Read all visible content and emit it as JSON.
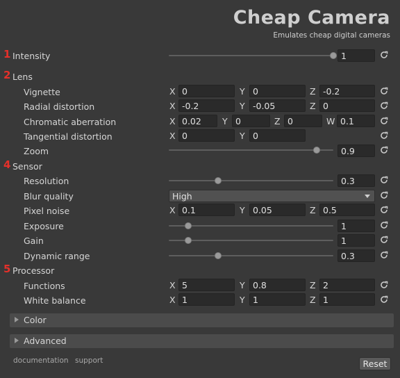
{
  "header": {
    "title": "Cheap Camera",
    "subtitle": "Emulates cheap digital cameras"
  },
  "sections": {
    "intensity": {
      "number": "1",
      "label": "Intensity",
      "value": "1",
      "level": 1.0
    },
    "lens": {
      "number": "2",
      "label": "Lens"
    },
    "sensor": {
      "number": "4",
      "label": "Sensor"
    },
    "processor": {
      "number": "5",
      "label": "Processor"
    }
  },
  "lens": {
    "vignette": {
      "label": "Vignette",
      "x": "0",
      "y": "0",
      "z": "-0.2"
    },
    "radial": {
      "label": "Radial distortion",
      "x": "-0.2",
      "y": "-0.05",
      "z": "0"
    },
    "chromatic": {
      "label": "Chromatic aberration",
      "x": "0.02",
      "y": "0",
      "z": "0",
      "w": "0.1"
    },
    "tangential": {
      "label": "Tangential distortion",
      "x": "0",
      "y": "0"
    },
    "zoom": {
      "label": "Zoom",
      "value": "0.9",
      "level": 0.9
    }
  },
  "sensor": {
    "resolution": {
      "label": "Resolution",
      "value": "0.3",
      "level": 0.3
    },
    "blur": {
      "label": "Blur quality",
      "selected": "High"
    },
    "noise": {
      "label": "Pixel noise",
      "x": "0.1",
      "y": "0.05",
      "z": "0.5"
    },
    "exposure": {
      "label": "Exposure",
      "value": "1",
      "level": 0.12
    },
    "gain": {
      "label": "Gain",
      "value": "1",
      "level": 0.12
    },
    "dynamic": {
      "label": "Dynamic range",
      "value": "0.3",
      "level": 0.3
    }
  },
  "processor": {
    "functions": {
      "label": "Functions",
      "x": "5",
      "y": "0.8",
      "z": "2"
    },
    "whitebalance": {
      "label": "White balance",
      "x": "1",
      "y": "1",
      "z": "1"
    }
  },
  "axes": {
    "x": "X",
    "y": "Y",
    "z": "Z",
    "w": "W"
  },
  "foldouts": {
    "color": "Color",
    "advanced": "Advanced"
  },
  "footer": {
    "documentation": "documentation",
    "support": "support",
    "reset": "Reset"
  },
  "colors": {
    "accent_red": "#e4302a",
    "background": "#393939",
    "field": "#2a2a2a"
  },
  "icons": {
    "reset": "circular-arrow-reset-icon",
    "dropdown": "triangle-down-icon",
    "foldout": "triangle-right-icon"
  }
}
